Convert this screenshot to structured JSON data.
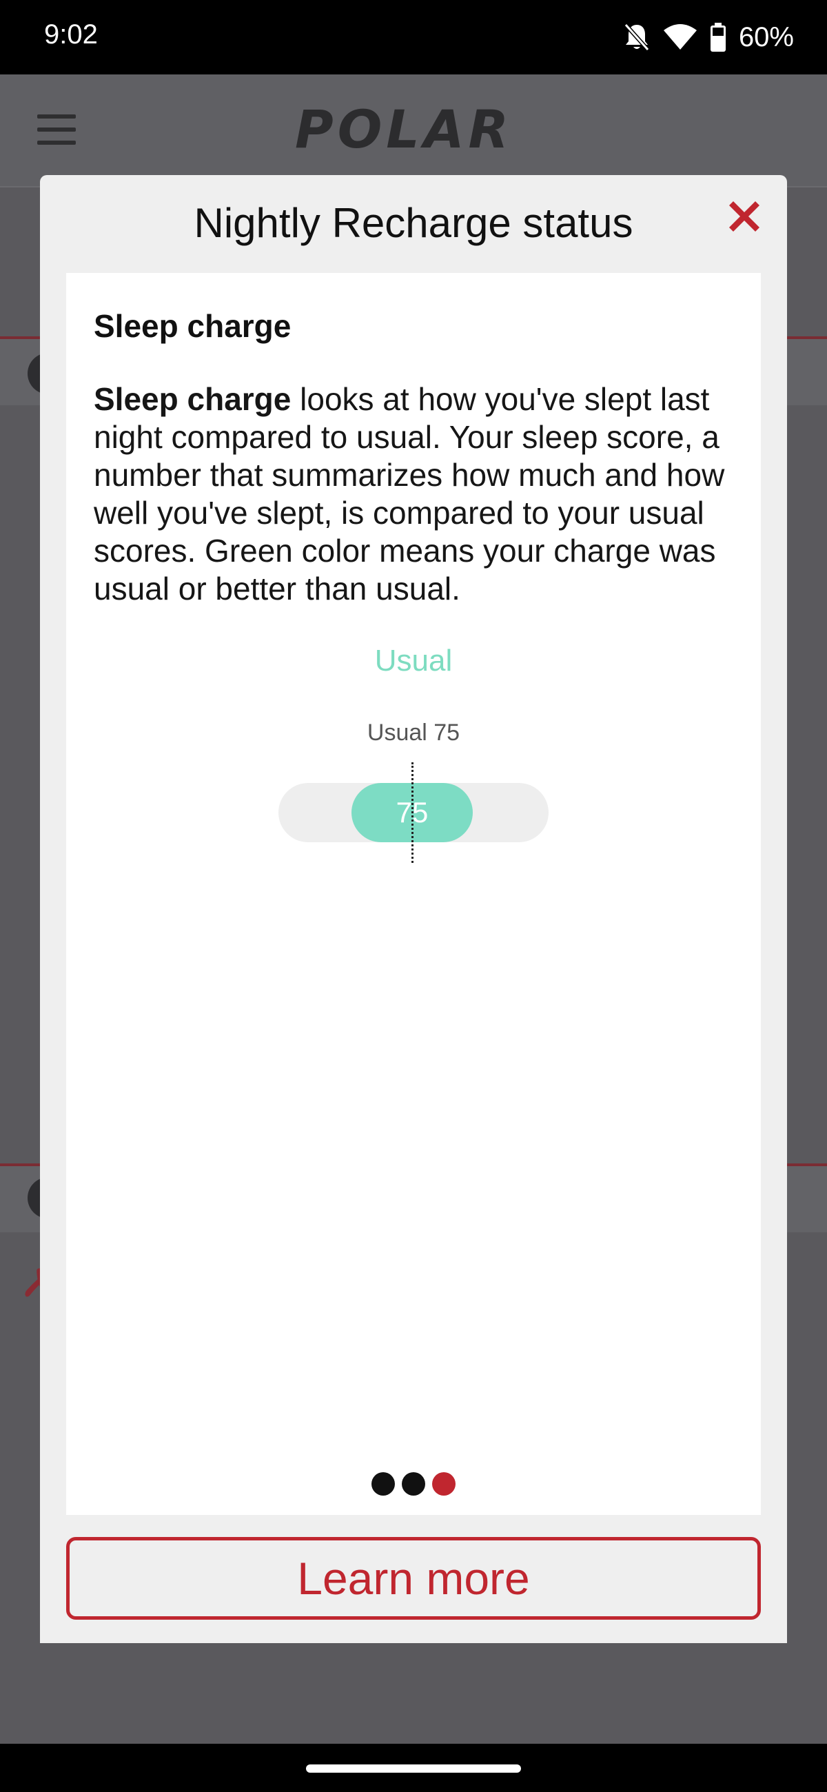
{
  "status_bar": {
    "time": "9:02",
    "battery": "60%",
    "icons": [
      "bell-off-icon",
      "wifi-icon",
      "battery-icon"
    ]
  },
  "app": {
    "brand": "POLAR"
  },
  "dialog": {
    "title": "Nightly Recharge status",
    "close_icon": "close-icon",
    "section_heading": "Sleep charge",
    "description_bold": "Sleep charge",
    "description_rest": " looks at how you've slept last night compared to usual. Your sleep score, a number that summarizes how much and how well you've slept, is compared to your usual scores. Green color means your charge was usual or better than usual.",
    "status_label": "Usual",
    "usual_caption": "Usual 75",
    "score_value": "75",
    "pager": {
      "total": 3,
      "active_index": 2
    },
    "learn_more_label": "Learn more"
  },
  "colors": {
    "accent_red": "#c0262f",
    "usual_green": "#7ddcc4",
    "overlay": "#5a595d"
  }
}
